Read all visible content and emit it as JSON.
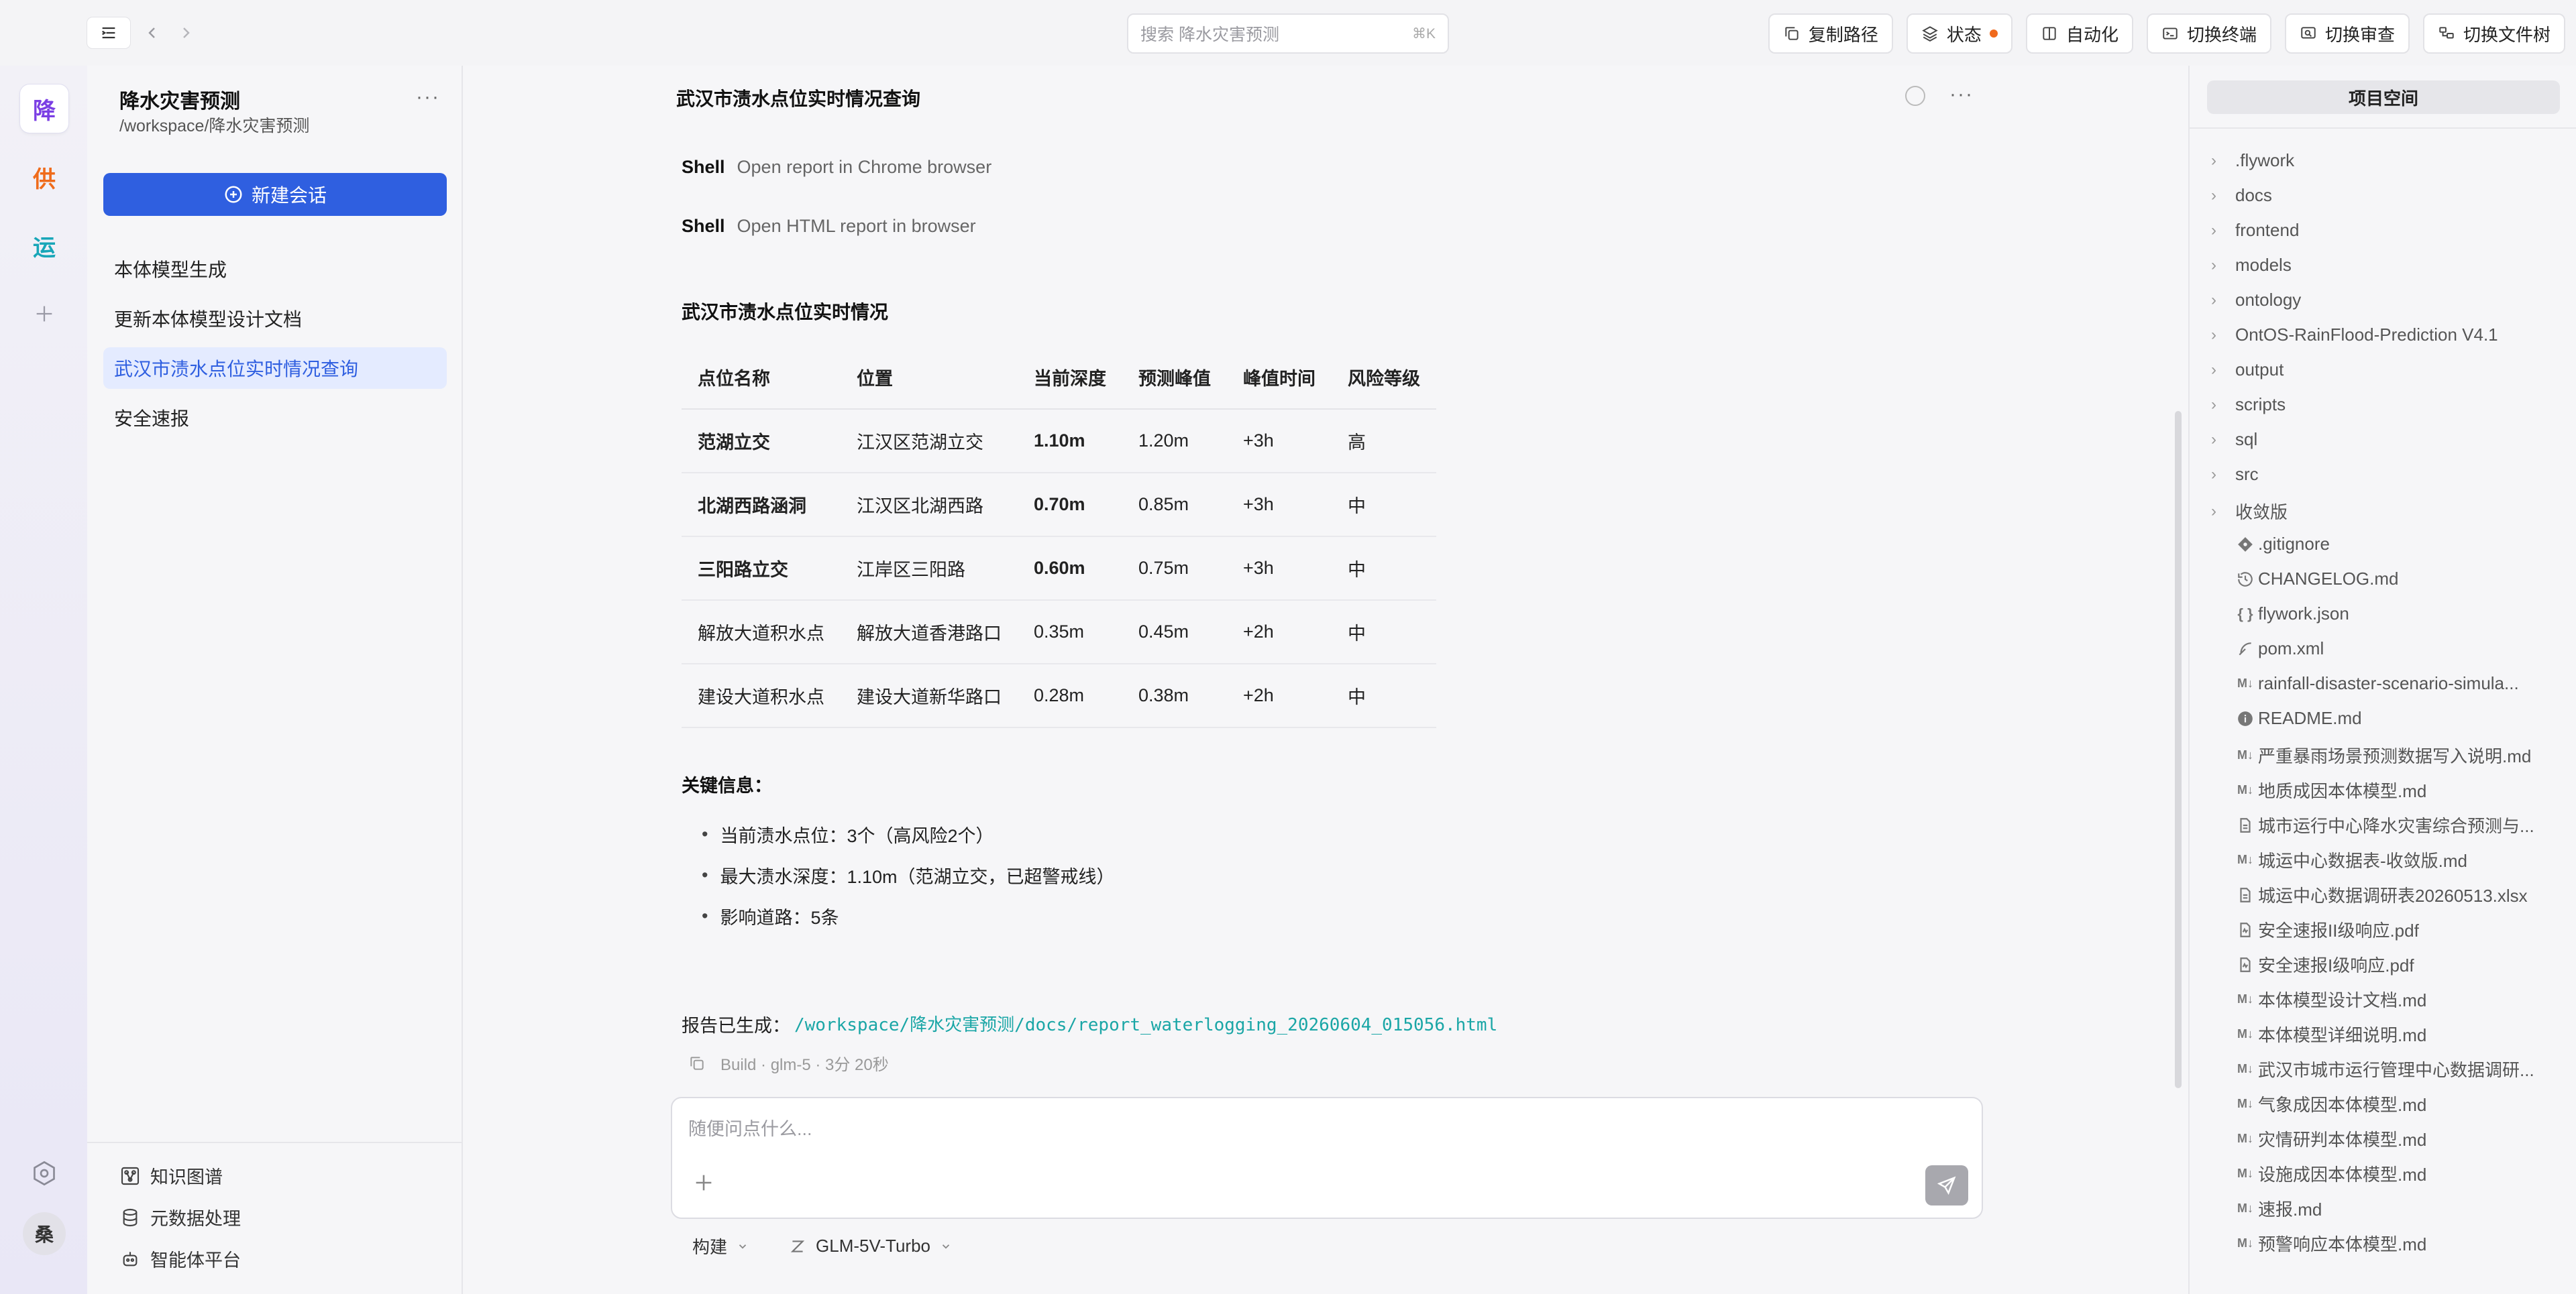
{
  "search": {
    "placeholder": "搜索 降水灾害预测",
    "shortcut": "⌘K"
  },
  "top_actions": [
    {
      "label": "复制路径",
      "icon": "copy-icon"
    },
    {
      "label": "状态",
      "icon": "layers-icon"
    },
    {
      "label": "自动化",
      "icon": "book-icon"
    },
    {
      "label": "切换终端",
      "icon": "terminal-icon"
    },
    {
      "label": "切换审查",
      "icon": "review-icon"
    },
    {
      "label": "切换文件树",
      "icon": "filetree-icon"
    }
  ],
  "rail": {
    "workspaces": [
      "降",
      "供",
      "运"
    ],
    "avatar": "桑"
  },
  "project": {
    "title": "降水灾害预测",
    "path": "/workspace/降水灾害预测"
  },
  "new_chat": "新建会话",
  "sessions": [
    "本体模型生成",
    "更新本体模型设计文档",
    "武汉市渍水点位实时情况查询",
    "安全速报"
  ],
  "footer_links": [
    "知识图谱",
    "元数据处理",
    "智能体平台"
  ],
  "conversation": {
    "title": "武汉市渍水点位实时情况查询",
    "shell_lines": [
      {
        "tag": "Shell",
        "text": "Open report in Chrome browser"
      },
      {
        "tag": "Shell",
        "text": "Open HTML report in browser"
      }
    ],
    "section_title": "武汉市渍水点位实时情况",
    "table": {
      "headers": [
        "点位名称",
        "位置",
        "当前深度",
        "预测峰值",
        "峰值时间",
        "风险等级"
      ],
      "rows": [
        [
          "范湖立交",
          "江汉区范湖立交",
          "1.10m",
          "1.20m",
          "+3h",
          "高"
        ],
        [
          "北湖西路涵洞",
          "江汉区北湖西路",
          "0.70m",
          "0.85m",
          "+3h",
          "中"
        ],
        [
          "三阳路立交",
          "江岸区三阳路",
          "0.60m",
          "0.75m",
          "+3h",
          "中"
        ],
        [
          "解放大道积水点",
          "解放大道香港路口",
          "0.35m",
          "0.45m",
          "+2h",
          "中"
        ],
        [
          "建设大道积水点",
          "建设大道新华路口",
          "0.28m",
          "0.38m",
          "+2h",
          "中"
        ]
      ]
    },
    "key_title": "关键信息：",
    "bullets": [
      "当前渍水点位：3个（高风险2个）",
      "最大渍水深度：1.10m（范湖立交，已超警戒线）",
      "影响道路：5条"
    ],
    "report_prefix": "报告已生成：",
    "report_link": "/workspace/降水灾害预测/docs/report_waterlogging_20260604_015056.html",
    "build_info": "Build · glm-5 · 3分 20秒"
  },
  "composer": {
    "placeholder": "随便问点什么..."
  },
  "modes": {
    "build": "构建",
    "model": "GLM-5V-Turbo"
  },
  "project_space": {
    "tab": "项目空间",
    "folders": [
      ".flywork",
      "docs",
      "frontend",
      "models",
      "ontology",
      "OntOS-RainFlood-Prediction V4.1",
      "output",
      "scripts",
      "sql",
      "src",
      "收敛版"
    ],
    "files": [
      {
        "name": ".gitignore",
        "icon": "git-icon"
      },
      {
        "name": "CHANGELOG.md",
        "icon": "history-icon"
      },
      {
        "name": "flywork.json",
        "icon": "json-icon"
      },
      {
        "name": "pom.xml",
        "icon": "feather-icon"
      },
      {
        "name": "rainfall-disaster-scenario-simula...",
        "icon": "markdown-icon"
      },
      {
        "name": "README.md",
        "icon": "info-icon"
      },
      {
        "name": "严重暴雨场景预测数据写入说明.md",
        "icon": "markdown-icon"
      },
      {
        "name": "地质成因本体模型.md",
        "icon": "markdown-icon"
      },
      {
        "name": "城市运行中心降水灾害综合预测与...",
        "icon": "doc-icon"
      },
      {
        "name": "城运中心数据表-收敛版.md",
        "icon": "markdown-icon"
      },
      {
        "name": "城运中心数据调研表20260513.xlsx",
        "icon": "doc-icon"
      },
      {
        "name": "安全速报II级响应.pdf",
        "icon": "pdf-icon"
      },
      {
        "name": "安全速报I级响应.pdf",
        "icon": "pdf-icon"
      },
      {
        "name": "本体模型设计文档.md",
        "icon": "markdown-icon"
      },
      {
        "name": "本体模型详细说明.md",
        "icon": "markdown-icon"
      },
      {
        "name": "武汉市城市运行管理中心数据调研...",
        "icon": "markdown-icon"
      },
      {
        "name": "气象成因本体模型.md",
        "icon": "markdown-icon"
      },
      {
        "name": "灾情研判本体模型.md",
        "icon": "markdown-icon"
      },
      {
        "name": "设施成因本体模型.md",
        "icon": "markdown-icon"
      },
      {
        "name": "速报.md",
        "icon": "markdown-icon"
      },
      {
        "name": "预警响应本体模型.md",
        "icon": "markdown-icon"
      }
    ]
  }
}
